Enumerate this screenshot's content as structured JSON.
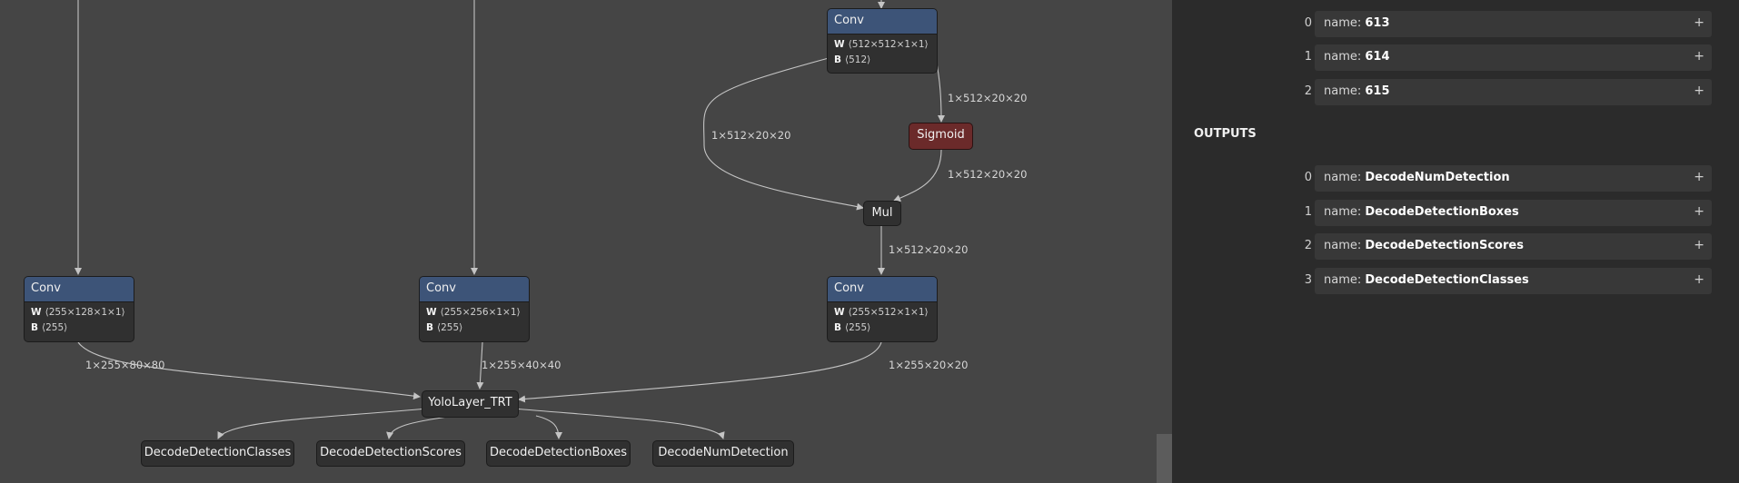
{
  "graph": {
    "nodes": {
      "conv_top": {
        "title": "Conv",
        "w": "⟨512×512×1×1⟩",
        "b": "⟨512⟩"
      },
      "sigmoid": {
        "title": "Sigmoid"
      },
      "mul": {
        "title": "Mul"
      },
      "conv_a": {
        "title": "Conv",
        "w": "⟨255×128×1×1⟩",
        "b": "⟨255⟩"
      },
      "conv_b": {
        "title": "Conv",
        "w": "⟨255×256×1×1⟩",
        "b": "⟨255⟩"
      },
      "conv_c": {
        "title": "Conv",
        "w": "⟨255×512×1×1⟩",
        "b": "⟨255⟩"
      },
      "yolo": {
        "title": "YoloLayer_TRT"
      },
      "out_classes": {
        "title": "DecodeDetectionClasses"
      },
      "out_scores": {
        "title": "DecodeDetectionScores"
      },
      "out_boxes": {
        "title": "DecodeDetectionBoxes"
      },
      "out_num": {
        "title": "DecodeNumDetection"
      }
    },
    "attr_w": "W",
    "attr_b": "B",
    "edge_labels": {
      "conv_to_mul": "1×512×20×20",
      "conv_to_sigmoid": "1×512×20×20",
      "sigmoid_to_mul": "1×512×20×20",
      "mul_to_conv": "1×512×20×20",
      "conv_a_out": "1×255×80×80",
      "conv_b_out": "1×255×40×40",
      "conv_c_out": "1×255×20×20"
    }
  },
  "panel": {
    "inputs": [
      {
        "index": "0",
        "prefix": "name: ",
        "name": "613"
      },
      {
        "index": "1",
        "prefix": "name: ",
        "name": "614"
      },
      {
        "index": "2",
        "prefix": "name: ",
        "name": "615"
      }
    ],
    "outputs_heading": "OUTPUTS",
    "outputs": [
      {
        "index": "0",
        "prefix": "name: ",
        "name": "DecodeNumDetection"
      },
      {
        "index": "1",
        "prefix": "name: ",
        "name": "DecodeDetectionBoxes"
      },
      {
        "index": "2",
        "prefix": "name: ",
        "name": "DecodeDetectionScores"
      },
      {
        "index": "3",
        "prefix": "name: ",
        "name": "DecodeDetectionClasses"
      }
    ],
    "expand_symbol": "+"
  }
}
